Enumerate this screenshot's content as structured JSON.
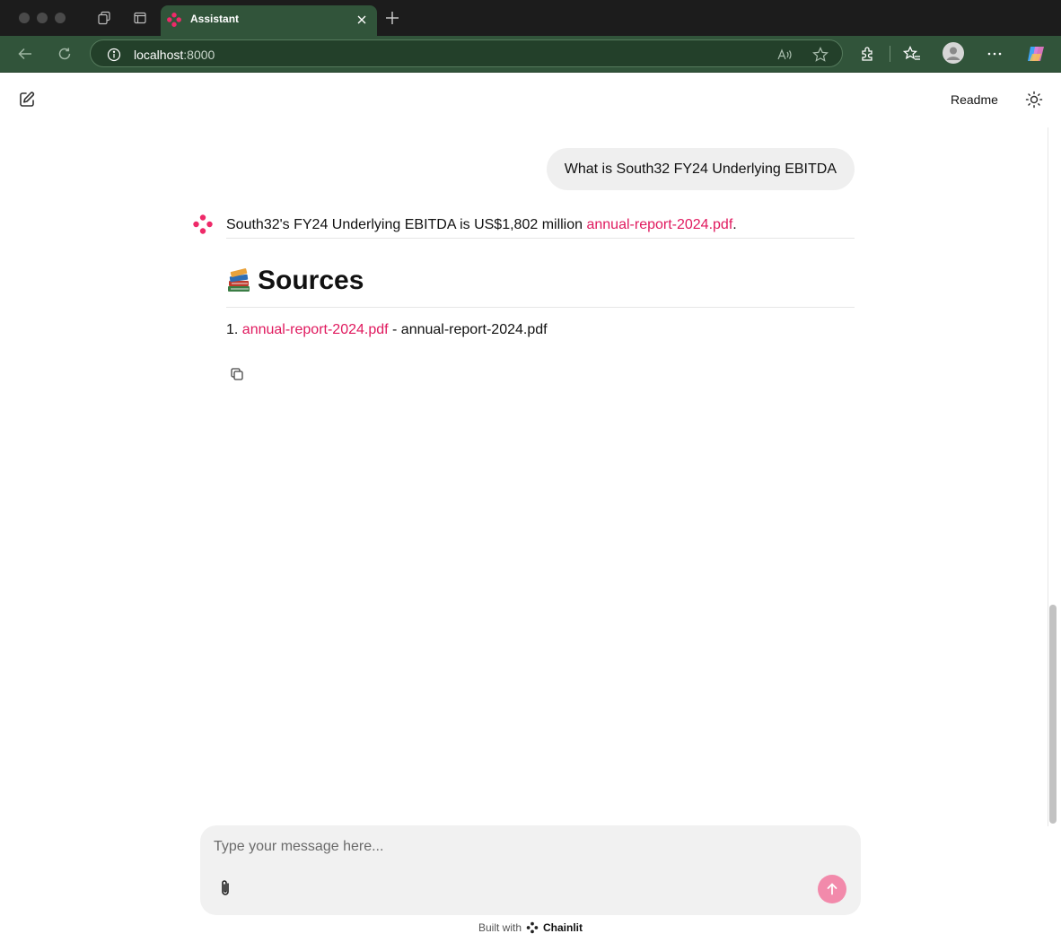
{
  "browser": {
    "tab": {
      "title": "Assistant"
    },
    "address": {
      "host": "localhost",
      "port": ":8000"
    }
  },
  "header": {
    "readme_label": "Readme"
  },
  "chat": {
    "user_message": "What is South32 FY24 Underlying EBITDA",
    "assistant": {
      "answer_text": "South32's FY24 Underlying EBITDA is US$1,802 million ",
      "answer_link": "annual-report-2024.pdf",
      "answer_suffix": ".",
      "sources_heading": "Sources",
      "sources": [
        {
          "number": "1.",
          "link": "annual-report-2024.pdf",
          "description": " - annual-report-2024.pdf"
        }
      ]
    }
  },
  "composer": {
    "placeholder": "Type your message here..."
  },
  "footer": {
    "built_with": "Built with",
    "brand": "Chainlit"
  },
  "colors": {
    "accent": "#e0195e",
    "browser_chrome": "#31543a",
    "send_button": "#f28aab"
  },
  "icons": {
    "app_logo": "chainlit-logo-icon",
    "sources_emoji": "books-icon",
    "copy": "copy-icon",
    "attach": "paperclip-icon",
    "send": "arrow-up-icon",
    "theme": "sun-icon",
    "new_chat": "edit-icon"
  }
}
